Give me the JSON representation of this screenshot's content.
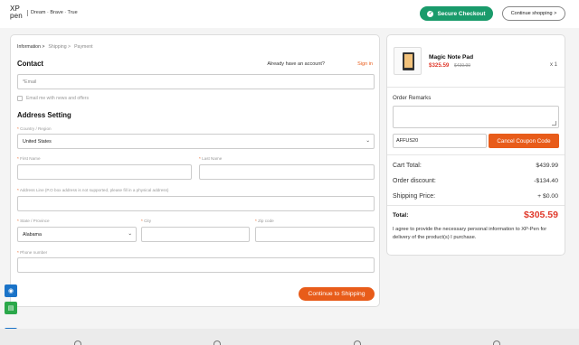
{
  "header": {
    "logo_line1": "XP",
    "logo_line2": "pen",
    "tagline": "Dream · Brave · True",
    "secure_checkout_label": "Secure Checkout",
    "continue_shopping_label": "Continue shopping >"
  },
  "steps": [
    "Information >",
    "Shipping >",
    "Payment"
  ],
  "contact": {
    "title": "Contact",
    "login_prompt": "Already have an account?",
    "signin_label": "Sign in",
    "email_placeholder": "*Email",
    "newsletter_label": "Email me with news and offers"
  },
  "address": {
    "title": "Address Setting",
    "country_label": "Country / Region",
    "country_value": "United States",
    "first_name_label": "First Name",
    "last_name_label": "Last Name",
    "address_label": "Address Line (P.O box address is not supported, please fill in a physical address)",
    "state_label": "State / Province",
    "state_value": "Alabama",
    "city_label": "City",
    "zip_label": "Zip code",
    "phone_label": "Phone number"
  },
  "submit_label": "Continue to Shipping",
  "summary": {
    "product_name": "Magic Note Pad",
    "product_price": "$325.59",
    "product_old_price": "$439.99",
    "product_qty": "x 1",
    "remarks_label": "Order Remarks",
    "coupon_value": "AFFUS20",
    "coupon_button": "Cancel Coupon Code",
    "cart_total_label": "Cart Total:",
    "cart_total_value": "$439.99",
    "discount_label": "Order discount:",
    "discount_value": "-$134.40",
    "shipping_label": "Shipping Price:",
    "shipping_value": "+ $0.00",
    "total_label": "Total:",
    "total_value": "$305.59",
    "agree_text": "I agree to provide the necessary personal information to XP-Pen for delivery of the product(s) I purchase."
  },
  "colors": {
    "accent": "#e85c1a",
    "secure": "#1a9b6b",
    "price": "#e03a2c",
    "tool_blue": "#1a73c8",
    "tool_green": "#2ba84a"
  },
  "side_tools": [
    "eye-icon",
    "chat-icon",
    "settings-icon"
  ]
}
